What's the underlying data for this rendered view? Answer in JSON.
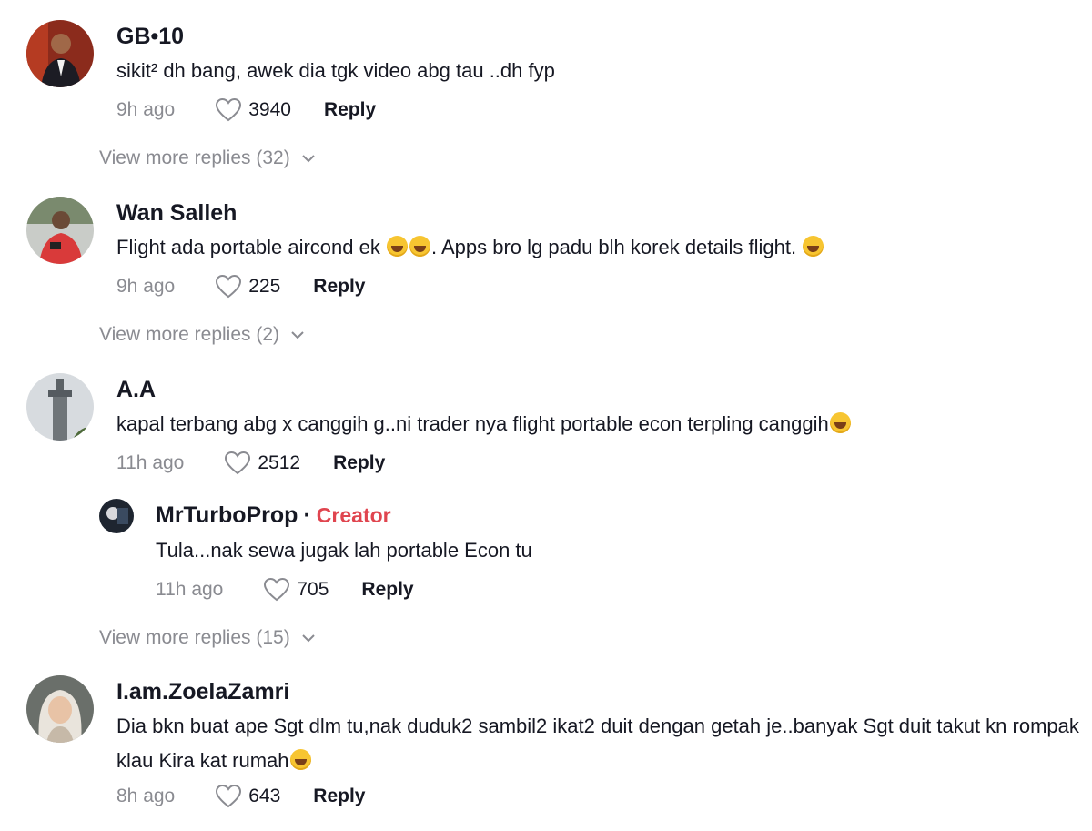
{
  "comments": [
    {
      "username": "GB•10",
      "text": "sikit² dh bang, awek dia tgk video abg tau ..dh fyp",
      "time": "9h ago",
      "likes": "3940",
      "reply_label": "Reply",
      "view_more": "View more replies (32)"
    },
    {
      "username": "Wan Salleh",
      "text_a": "Flight ada portable aircond ek ",
      "text_b": ". Apps bro lg padu blh korek details flight. ",
      "time": "9h ago",
      "likes": "225",
      "reply_label": "Reply",
      "view_more": "View more replies (2)"
    },
    {
      "username": "A.A",
      "text": "kapal terbang abg x canggih g..ni trader nya flight portable econ terpling canggih",
      "time": "11h ago",
      "likes": "2512",
      "reply_label": "Reply",
      "replies": [
        {
          "username": "MrTurboProp",
          "badge": "Creator",
          "text": "Tula...nak sewa jugak lah portable Econ tu",
          "time": "11h ago",
          "likes": "705",
          "reply_label": "Reply"
        }
      ],
      "view_more": "View more replies (15)"
    },
    {
      "username": "I.am.ZoelaZamri",
      "text": "Dia bkn buat ape Sgt dlm tu,nak duduk2 sambil2 ikat2 duit dengan getah je..banyak Sgt duit takut kn rompak klau Kira kat rumah",
      "time": "8h ago",
      "likes": "643",
      "reply_label": "Reply"
    }
  ],
  "icons": {
    "like": "heart-outline-icon",
    "expand": "chevron-down-icon"
  }
}
